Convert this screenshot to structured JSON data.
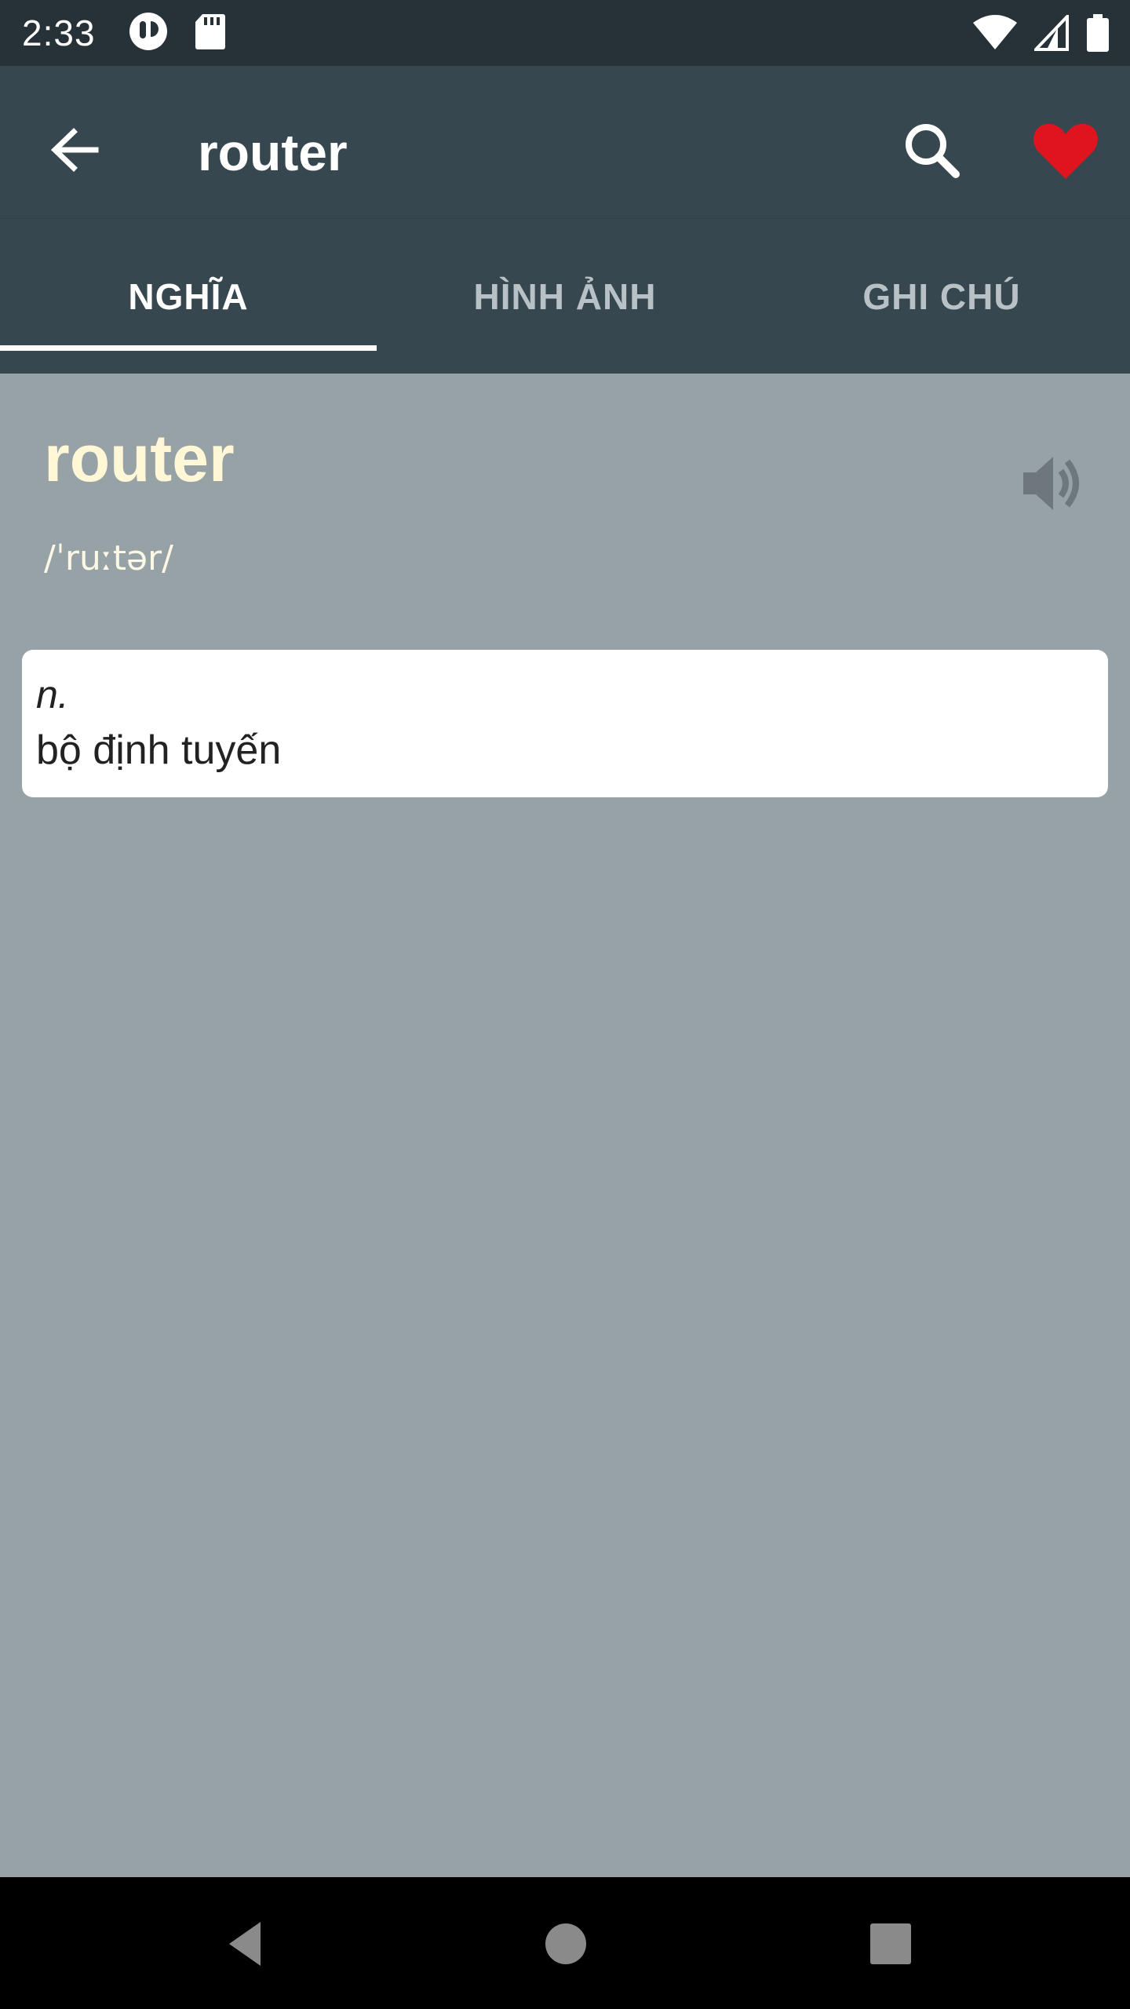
{
  "status": {
    "time": "2:33"
  },
  "app_bar": {
    "title": "router"
  },
  "tabs": [
    {
      "label": "NGHĨA"
    },
    {
      "label": "HÌNH ẢNH"
    },
    {
      "label": "GHI CHÚ"
    }
  ],
  "entry": {
    "word": "router",
    "phonetic": "/ˈruːtər/",
    "definitions": [
      {
        "part_of_speech": "n.",
        "meaning": "bộ định tuyến"
      }
    ]
  },
  "colors": {
    "app_bar": "#37474f",
    "status_bar": "#263238",
    "content_bg": "#97a2a7",
    "word": "#fff7d6",
    "favorite": "#e0141e"
  },
  "icons": {
    "back": "arrow-left-icon",
    "search": "search-icon",
    "favorite": "heart-icon",
    "speaker": "speaker-icon"
  }
}
